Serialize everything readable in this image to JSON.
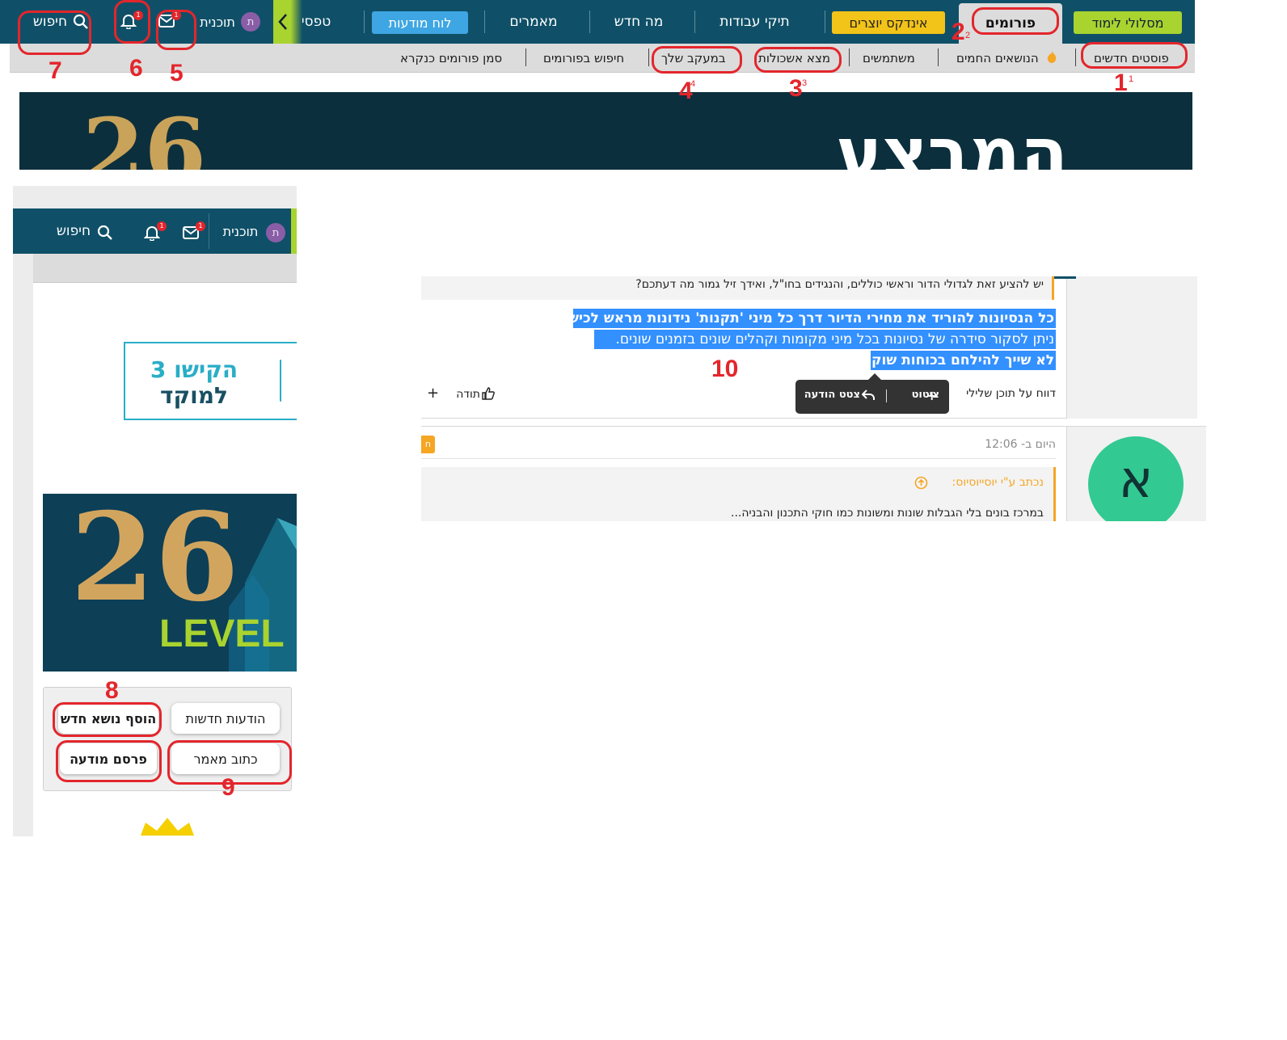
{
  "top_nav": {
    "learning_paths": "מסלולי לימוד",
    "forums": "פורומים",
    "creators_index": "אינדקס יוצרים",
    "portfolios": "תיקי עבודות",
    "whats_new": "מה חדש",
    "articles": "מאמרים",
    "job_board": "לוח מודעות",
    "tapasi": "טפסי",
    "user_name": "תוכנית",
    "user_initial": "ת",
    "inbox_count": "1",
    "alerts_count": "1",
    "search_label": "חיפוש"
  },
  "sub_nav": {
    "new_posts": "פוסטים חדשים",
    "hot_topics": "הנושאים החמים",
    "members": "משתמשים",
    "find_threads": "מצא אשכולות",
    "watched": "במעקב שלך",
    "search_forums": "חיפוש בפורומים",
    "mark_read": "סמן פורומים כנקרא"
  },
  "banner": {
    "headline_fragment": "המבצע",
    "logo_text": "26",
    "level_text": "LEVEL U",
    "promo_line1": "הקישו 3",
    "promo_line2": "למוקד"
  },
  "mini_nav": {
    "user_name": "תוכנית",
    "user_initial": "ת",
    "inbox_count": "1",
    "alerts_count": "1",
    "search_label": "חיפוש"
  },
  "side_buttons": {
    "new_messages": "הודעות חדשות",
    "add_topic": "הוסף נושא חדש",
    "write_article": "כתוב מאמר",
    "post_ad": "פרסם מודעה"
  },
  "post": {
    "quoted_text": "יש להציע זאת לגדולי הדור וראשי כוללים, והנגידים בחו\"ל, ואידך זיל גמור מה דעתכם?",
    "selected_lines": [
      "כל הנסיונות להוריד את מחירי הדיור דרך כל מיני 'תקנות' נידונות מראש לכישלון .",
      "ניתן לסקור סידרה של נסיונות בכל מיני מקומות וקהלים שונים בזמנים שונים.",
      "לא שייך להילחם בכוחות שוק !"
    ],
    "report_label": "דווח על תוכן שלילי",
    "like_label": "תודה",
    "tooltip_quote": "ציטוט",
    "tooltip_reply": "צטט הודעה"
  },
  "post2": {
    "time": "היום ב- 12:06",
    "quote_author": "נכתב ע\"י יוסייוסיוס:",
    "quote_text": "במרכז בונים בלי הגבלות שונות ומשונות כמו חוקי התכנון והבניה...",
    "avatar_letter": "א",
    "badge_text": "ח"
  },
  "annotations": {
    "n1": "1",
    "n1_sup": "1",
    "n2": "2",
    "n2_sup": "2",
    "n3": "3",
    "n3_sup": "3",
    "n4": "4",
    "n4_sup": "4",
    "n5": "5",
    "n6": "6",
    "n7": "7",
    "n8": "8",
    "n9": "9",
    "n10": "10"
  },
  "colors": {
    "nav_bg": "#0f5068",
    "green_pill": "#a9d32f",
    "yellow_pill": "#f2c318",
    "blue_pill": "#3ea6e2",
    "annotation_red": "#e3262c",
    "selection_blue": "#3390ff",
    "avatar_green": "#33c993"
  }
}
